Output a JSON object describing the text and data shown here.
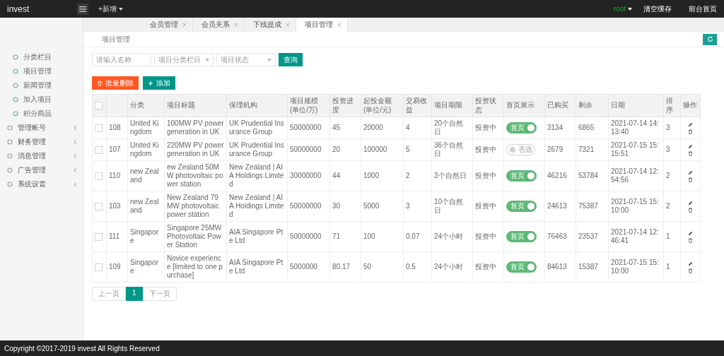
{
  "topbar": {
    "logo": "invest",
    "new_menu": "+新增",
    "user": "root",
    "links": [
      "清空缓存",
      "前台首页"
    ]
  },
  "sidebar": {
    "items": [
      {
        "label": "分类栏目",
        "kind": "sub"
      },
      {
        "label": "项目管理",
        "kind": "sub"
      },
      {
        "label": "新闻管理",
        "kind": "sub"
      },
      {
        "label": "加入项目",
        "kind": "sub"
      },
      {
        "label": "积分商品",
        "kind": "sub"
      },
      {
        "label": "管理帐号",
        "kind": "group"
      },
      {
        "label": "财务管理",
        "kind": "group"
      },
      {
        "label": "消息管理",
        "kind": "group"
      },
      {
        "label": "广告管理",
        "kind": "group"
      },
      {
        "label": "系统设置",
        "kind": "group"
      }
    ]
  },
  "tabs": [
    {
      "label": "会员管理",
      "selected": false
    },
    {
      "label": "会员关系",
      "selected": false
    },
    {
      "label": "下线提成",
      "selected": false
    },
    {
      "label": "项目管理",
      "selected": true
    }
  ],
  "breadcrumb": "项目管理",
  "filters": {
    "name_placeholder": "请输入名称",
    "category_placeholder": "项目分类栏目",
    "status_placeholder": "项目状态",
    "search_button": "查询"
  },
  "actions": [
    {
      "label": "批量删除",
      "kind": "delete"
    },
    {
      "label": "添加",
      "kind": "add"
    }
  ],
  "table": {
    "columns": [
      "分类",
      "项目标题",
      "保理机构",
      "项目规模(单位/万)",
      "投资进度",
      "起投金额(单位/元)",
      "交易收益",
      "项目期限",
      "投资状态",
      "首页展示",
      "已购买",
      "剩余",
      "日期",
      "排序",
      "操作"
    ],
    "header_checked": false,
    "rows": [
      {
        "checked": false,
        "id": "108",
        "category": "United Kingdom",
        "title": "100MW PV power generation in UK",
        "institution": "UK Prudential Insurance Group",
        "scale": "50000000",
        "progress": "45",
        "min_invest": "20000",
        "yield": "4",
        "term": "20个自然日",
        "status": "投资中",
        "home_on": true,
        "home_label": "首页",
        "bought": "3134",
        "remaining": "6865",
        "date": "2021-07-14 14:13:40",
        "sort": "3"
      },
      {
        "checked": false,
        "id": "107",
        "category": "United Kingdom",
        "title": "220MW PV power generation in UK",
        "institution": "UK Prudential Insurance Group",
        "scale": "50000000",
        "progress": "20",
        "min_invest": "100000",
        "yield": "5",
        "term": "36个自然日",
        "status": "投资中",
        "home_on": false,
        "home_label": "否选",
        "bought": "2679",
        "remaining": "7321",
        "date": "2021-07-15 15:15:51",
        "sort": "3"
      },
      {
        "checked": false,
        "id": "110",
        "category": "new Zealand",
        "title": "ew Zealand 50MW photovoltaic power station",
        "institution": "New Zealand | AIA Holdings Limited",
        "scale": "30000000",
        "progress": "44",
        "min_invest": "1000",
        "yield": "2",
        "term": "3个自然日",
        "status": "投资中",
        "home_on": true,
        "home_label": "首页",
        "bought": "46216",
        "remaining": "53784",
        "date": "2021-07-14 12:54:56",
        "sort": "2"
      },
      {
        "checked": false,
        "id": "103",
        "category": "new Zealand",
        "title": "New Zealand 79MW photovoltaic power station",
        "institution": "New Zealand | AIA Holdings Limited",
        "scale": "50000000",
        "progress": "30",
        "min_invest": "5000",
        "yield": "3",
        "term": "10个自然日",
        "status": "投资中",
        "home_on": true,
        "home_label": "首页",
        "bought": "24613",
        "remaining": "75387",
        "date": "2021-07-15 15:10:00",
        "sort": "2"
      },
      {
        "checked": false,
        "id": "111",
        "category": "Singapore",
        "title": "Singapore 25MW Photovoltaic Power Station",
        "institution": "AIA Singapore Pte Ltd",
        "scale": "50000000",
        "progress": "71",
        "min_invest": "100",
        "yield": "0.07",
        "term": "24个小时",
        "status": "投资中",
        "home_on": true,
        "home_label": "首页",
        "bought": "76463",
        "remaining": "23537",
        "date": "2021-07-14 12:46:41",
        "sort": "1"
      },
      {
        "checked": false,
        "id": "109",
        "category": "Singapore",
        "title": "Novice experience [limited to one purchase]",
        "institution": "AIA Singapore Pte Ltd",
        "scale": "5000000",
        "progress": "80.17",
        "min_invest": "50",
        "yield": "0.5",
        "term": "24个小时",
        "status": "投资中",
        "home_on": true,
        "home_label": "首页",
        "bought": "84613",
        "remaining": "15387",
        "date": "2021-07-15 15:10:00",
        "sort": "1"
      }
    ]
  },
  "pager": {
    "prev": "上一页",
    "pages": [
      {
        "label": "1",
        "selected": true
      }
    ],
    "next": "下一页"
  },
  "footer": "Copyright ©2017-2019 invest All Rights Reserved"
}
